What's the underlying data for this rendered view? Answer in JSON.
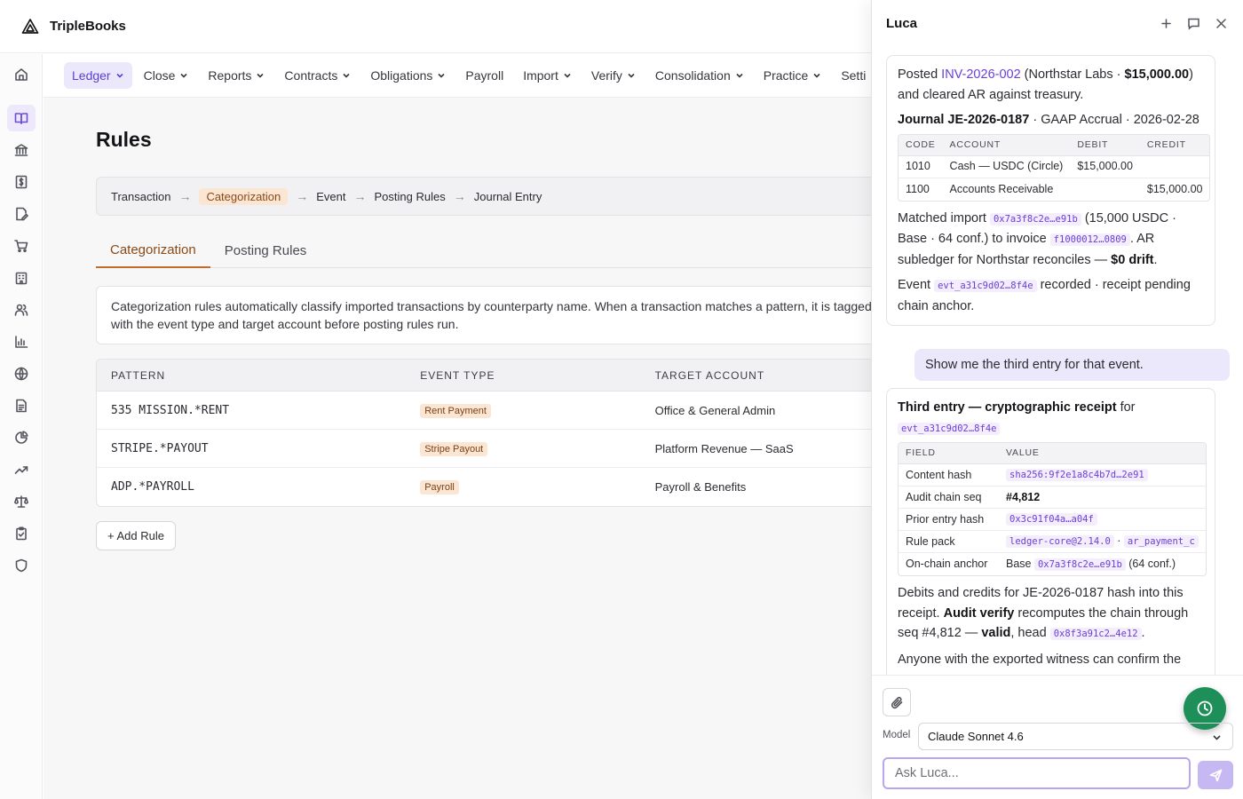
{
  "app": {
    "brand": "TripleBooks"
  },
  "nav": {
    "items": [
      {
        "label": "Ledger",
        "dropdown": true,
        "active": true
      },
      {
        "label": "Close",
        "dropdown": true
      },
      {
        "label": "Reports",
        "dropdown": true
      },
      {
        "label": "Contracts",
        "dropdown": true
      },
      {
        "label": "Obligations",
        "dropdown": true
      },
      {
        "label": "Payroll",
        "dropdown": false
      },
      {
        "label": "Import",
        "dropdown": true
      },
      {
        "label": "Verify",
        "dropdown": true
      },
      {
        "label": "Consolidation",
        "dropdown": true
      },
      {
        "label": "Practice",
        "dropdown": true
      },
      {
        "label": "Setti",
        "dropdown": false
      }
    ]
  },
  "sidebar": {
    "icons": [
      "home-icon",
      "book-icon",
      "bank-icon",
      "receipt-dollar-icon",
      "document-edit-icon",
      "cart-icon",
      "building-icon",
      "users-icon",
      "bar-chart-icon",
      "globe-icon",
      "document-icon",
      "pie-chart-icon",
      "trending-up-icon",
      "scale-icon",
      "clipboard-check-icon",
      "shield-icon"
    ],
    "active_index": 1
  },
  "page": {
    "title": "Rules",
    "pipeline": [
      "Transaction",
      "Categorization",
      "Event",
      "Posting Rules",
      "Journal Entry"
    ],
    "pipeline_highlight": "Categorization",
    "pipeline_arrow": "→",
    "tabs": [
      {
        "label": "Categorization",
        "active": true
      },
      {
        "label": "Posting Rules",
        "active": false
      }
    ],
    "description": "Categorization rules automatically classify imported transactions by counterparty name. When a transaction matches a pattern, it is tagged with the event type and target account before posting rules run.",
    "table": {
      "headers": [
        "PATTERN",
        "EVENT TYPE",
        "TARGET ACCOUNT"
      ],
      "rows": [
        {
          "pattern": "535 MISSION.*RENT",
          "event_type": "Rent Payment",
          "account": "Office & General Admin"
        },
        {
          "pattern": "STRIPE.*PAYOUT",
          "event_type": "Stripe Payout",
          "account": "Platform Revenue — SaaS"
        },
        {
          "pattern": "ADP.*PAYROLL",
          "event_type": "Payroll",
          "account": "Payroll & Benefits"
        }
      ]
    },
    "add_rule_label": "+ Add Rule"
  },
  "chat": {
    "title": "Luca",
    "msg1": {
      "posted_prefix": "Posted ",
      "invoice_link": "INV-2026-002",
      "posted_mid": " (Northstar Labs · ",
      "posted_amount": "$15,000.00",
      "posted_suffix": ") and cleared AR against treasury.",
      "journal_bold": "Journal JE-2026-0187",
      "journal_rest": " · GAAP Accrual · 2026-02-28",
      "journal_table": {
        "headers": [
          "CODE",
          "ACCOUNT",
          "DEBIT",
          "CREDIT"
        ],
        "rows": [
          {
            "code": "1010",
            "account": "Cash — USDC (Circle)",
            "debit": "$15,000.00",
            "credit": ""
          },
          {
            "code": "1100",
            "account": "Accounts Receivable",
            "debit": "",
            "credit": "$15,000.00"
          }
        ]
      },
      "matched_prefix": "Matched import ",
      "matched_hash": "0x7a3f8c2e…e91b",
      "matched_mid": " (15,000 USDC · Base · 64 conf.) to invoice ",
      "matched_invoice_hash": "f1000012…0809",
      "matched_suffix": ". AR subledger for Northstar reconciles — ",
      "matched_drift": "$0 drift",
      "matched_end": ".",
      "event_prefix": "Event ",
      "event_code": "evt_a31c9d02…8f4e",
      "event_suffix": " recorded · receipt pending chain anchor."
    },
    "user_msg": "Show me the third entry for that event.",
    "msg2": {
      "heading_bold": "Third entry — cryptographic receipt",
      "heading_for": " for ",
      "event_code": "evt_a31c9d02…8f4e",
      "receipt_table": {
        "headers": [
          "FIELD",
          "VALUE"
        ],
        "content_hash_label": "Content hash",
        "content_hash": "sha256:9f2e1a8c4b7d…2e91",
        "audit_seq_label": "Audit chain seq",
        "audit_seq": "#4,812",
        "prior_hash_label": "Prior entry hash",
        "prior_hash": "0x3c91f04a…a04f",
        "rule_pack_label": "Rule pack",
        "rule_pack_1": "ledger-core@2.14.0",
        "rule_pack_sep": " · ",
        "rule_pack_2": "ar_payment_c",
        "anchor_label": "On-chain anchor",
        "anchor_chain": "Base ",
        "anchor_hash": "0x7a3f8c2e…e91b",
        "anchor_conf": " (64 conf.)"
      },
      "p1_a": "Debits and credits for JE-2026-0187 hash into this receipt. ",
      "p1_bold1": "Audit verify",
      "p1_b": " recomputes the chain through seq #4,812 — ",
      "p1_bold2": "valid",
      "p1_c": ", head ",
      "p1_head": "0x8f3a91c2…4e12",
      "p1_d": ".",
      "p2": "Anyone with the exported witness can confirm the"
    },
    "model_label": "Model",
    "model_value": "Claude Sonnet 4.6",
    "input_placeholder": "Ask Luca..."
  }
}
